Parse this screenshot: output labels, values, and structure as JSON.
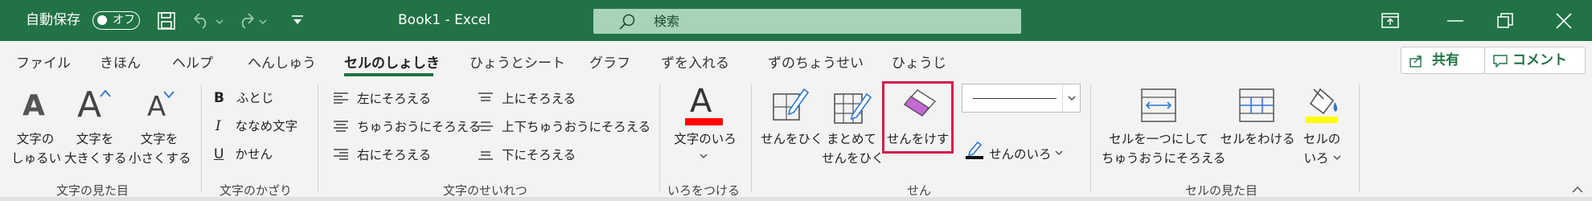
{
  "titlebar": {
    "autosave_label": "自動保存",
    "autosave_state": "オフ",
    "doc_title": "Book1  -  Excel",
    "search_placeholder": "検索"
  },
  "tabs": [
    "ファイル",
    "きほん",
    "ヘルプ",
    "へんしゅう",
    "セルのしょしき",
    "ひょうとシート",
    "グラフ",
    "ずを入れる",
    "ずのちょうせい",
    "ひょうじ"
  ],
  "active_tab": "セルのしょしき",
  "share_label": "共有",
  "comment_label": "コメント",
  "groups": {
    "text_appearance": {
      "label": "文字の見た目",
      "btn_font_type": [
        "文字の",
        "しゅるい"
      ],
      "btn_font_bigger": [
        "文字を",
        "大きくする"
      ],
      "btn_font_smaller": [
        "文字を",
        "小さくする"
      ]
    },
    "text_decoration": {
      "label": "文字のかざり",
      "bold": "ふとじ",
      "italic": "ななめ文字",
      "underline": "かせん"
    },
    "alignment": {
      "label": "文字のせいれつ",
      "left": "左にそろえる",
      "center": "ちゅうおうにそろえる",
      "right": "右にそろえる",
      "top": "上にそろえる",
      "vcenter": "上下ちゅうおうにそろえる",
      "bottom": "下にそろえる"
    },
    "color": {
      "label": "いろをつける",
      "font_color": "文字のいろ",
      "font_color_swatch": "#ff0000"
    },
    "borders": {
      "label": "せん",
      "draw": "せんをひく",
      "draw_grid": [
        "まとめて",
        "せんをひく"
      ],
      "erase": "せんをけす",
      "line_color": "せんのいろ"
    },
    "cell_appearance": {
      "label": "セルの見た目",
      "merge": [
        "セルを一つにして",
        "ちゅうおうにそろえる"
      ],
      "split": "セルをわける",
      "fill": [
        "セルの",
        "いろ"
      ],
      "fill_swatch": "#ffff00"
    }
  },
  "accent_color": "#217346",
  "highlight_color": "#d41c4a"
}
